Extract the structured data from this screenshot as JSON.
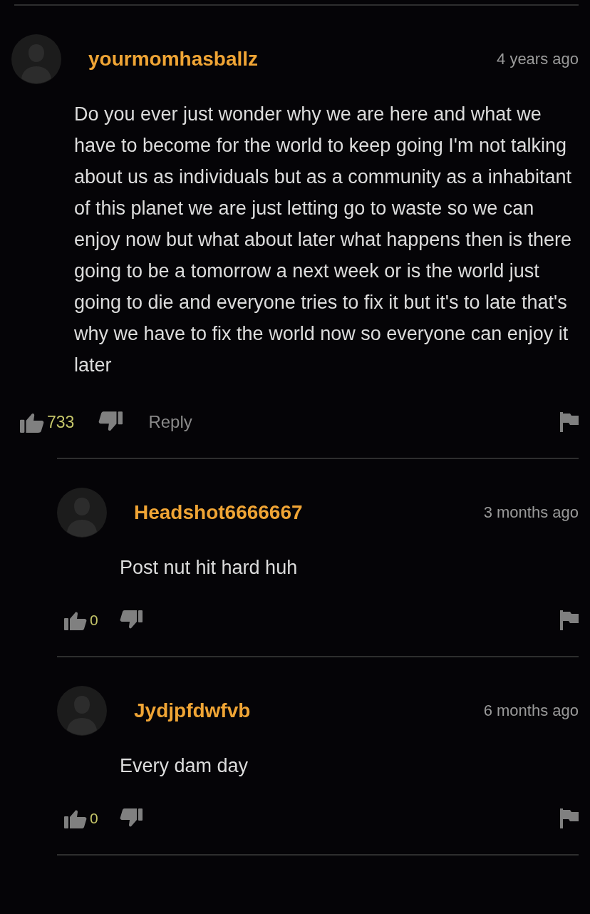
{
  "comments": [
    {
      "username": "yourmomhasballz",
      "time": "4 years ago",
      "text": "Do you ever just wonder why we are here and what we have to become for the world to keep going I'm not talking about us as individuals but as a community as a inhabitant of this planet we are just letting go to waste so we can enjoy now but what about later what happens then is there going to be a tomorrow a next week or is the world just going to die and everyone tries to fix it but it's to late that's why we have to fix the world now so everyone can enjoy it later",
      "likes": "733",
      "reply_label": "Reply",
      "children": [
        {
          "username": "Headshot6666667",
          "time": "3 months ago",
          "text": "Post nut hit hard huh",
          "likes": "0"
        },
        {
          "username": "Jydjpfdwfvb",
          "time": "6 months ago",
          "text": "Every dam day",
          "likes": "0"
        }
      ]
    }
  ]
}
